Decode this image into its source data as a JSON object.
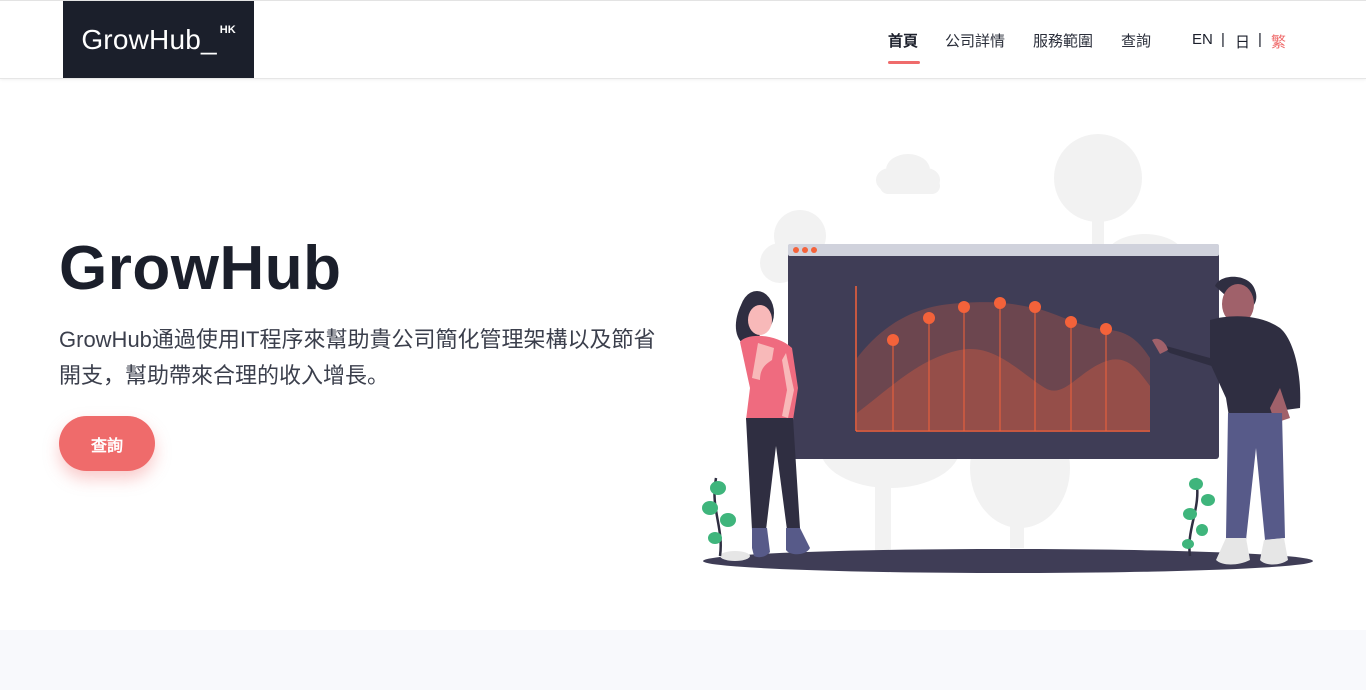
{
  "brand": {
    "name": "GrowHub_",
    "suffix": "HK"
  },
  "nav": {
    "items": [
      {
        "label": "首頁",
        "active": true
      },
      {
        "label": "公司詳情",
        "active": false
      },
      {
        "label": "服務範圍",
        "active": false
      },
      {
        "label": "查詢",
        "active": false
      }
    ],
    "languages": [
      {
        "label": "EN",
        "selected": false
      },
      {
        "label": "日",
        "selected": false
      },
      {
        "label": "繁",
        "selected": true
      }
    ],
    "separator": "|"
  },
  "hero": {
    "title": "GrowHub",
    "description": "GrowHub通過使用IT程序來幫助貴公司簡化管理架構以及節省開支，幫助帶來合理的收入增長。",
    "cta_label": "查詢"
  },
  "colors": {
    "accent": "#ef6b6b",
    "dark": "#1b1f2b",
    "screen": "#3f3d56",
    "chart_accent": "#f4623a"
  },
  "illustration": {
    "icons": [
      "presentation-screen-illustration",
      "woman-figure",
      "man-figure",
      "plant-icon"
    ]
  }
}
